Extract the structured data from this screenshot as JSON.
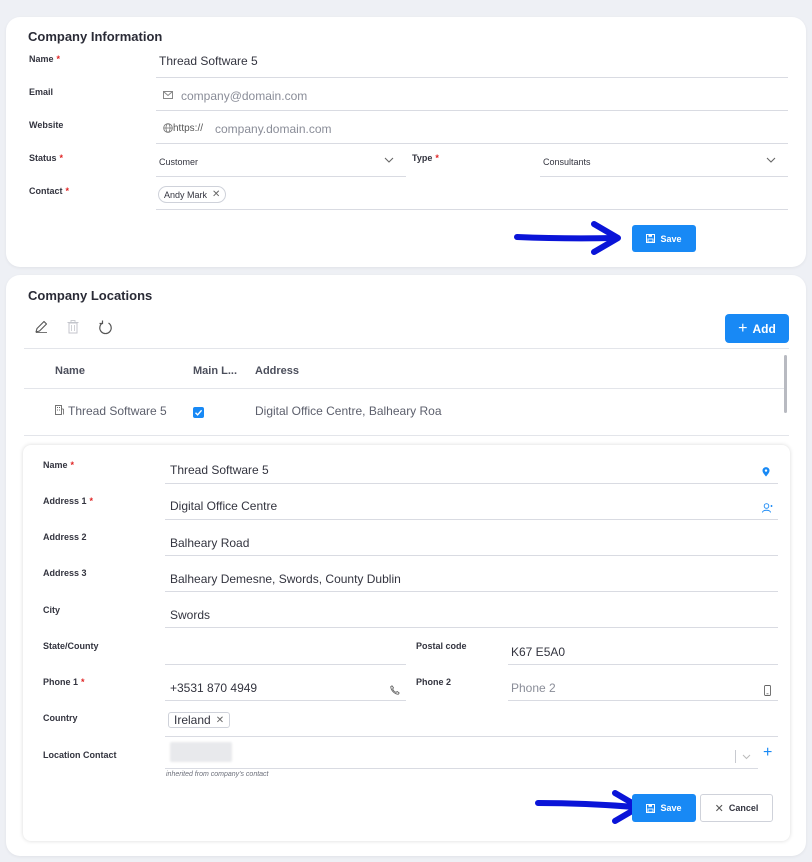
{
  "company_info": {
    "title": "Company Information",
    "name_label": "Name",
    "name_value": "Thread Software 5",
    "email_label": "Email",
    "email_placeholder": "company@domain.com",
    "website_label": "Website",
    "website_prefix": "https://",
    "website_placeholder": "company.domain.com",
    "status_label": "Status",
    "status_value": "Customer",
    "type_label": "Type",
    "type_value": "Consultants",
    "contact_label": "Contact",
    "contact_chip": "Andy Mark",
    "save_label": "Save"
  },
  "locations": {
    "title": "Company Locations",
    "add_label": "Add",
    "columns": [
      "Name",
      "Main L...",
      "Address"
    ],
    "rows": [
      {
        "name": "Thread Software 5",
        "main": true,
        "address": "Digital Office Centre, Balheary Roa"
      }
    ]
  },
  "location_form": {
    "name_label": "Name",
    "name_value": "Thread Software 5",
    "address1_label": "Address 1",
    "address1_value": "Digital Office Centre",
    "address2_label": "Address 2",
    "address2_value": "Balheary Road",
    "address3_label": "Address 3",
    "address3_value": "Balheary Demesne, Swords, County Dublin",
    "city_label": "City",
    "city_value": "Swords",
    "state_label": "State/County",
    "state_value": "",
    "postal_label": "Postal code",
    "postal_value": "K67 E5A0",
    "phone1_label": "Phone 1",
    "phone1_value": "+3531 870 4949",
    "phone2_label": "Phone 2",
    "phone2_placeholder": "Phone 2",
    "country_label": "Country",
    "country_chip": "Ireland",
    "location_contact_label": "Location Contact",
    "location_contact_hint": "inherited from company's contact",
    "save_label": "Save",
    "cancel_label": "Cancel"
  },
  "colors": {
    "accent": "#1889f5",
    "arrow": "#0a14d8",
    "required": "#e02424"
  }
}
